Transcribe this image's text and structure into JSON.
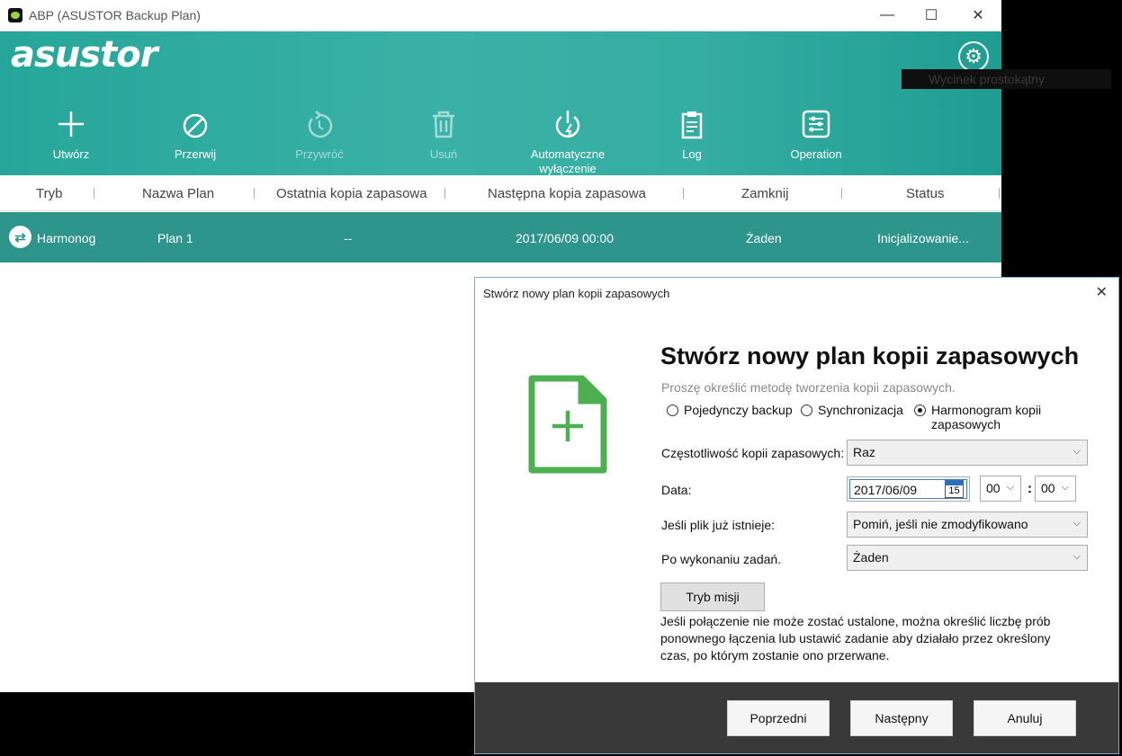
{
  "window": {
    "title": "ABP (ASUSTOR Backup Plan)",
    "minimize": "—",
    "maximize": "☐",
    "close": "✕"
  },
  "header": {
    "logo": "asustor",
    "settings_icon": "gear-icon"
  },
  "toolbar": [
    {
      "label": "Utwórz",
      "icon": "plus-icon",
      "enabled": true
    },
    {
      "label": "Przerwij",
      "icon": "cancel-icon",
      "enabled": true
    },
    {
      "label": "Przywróć",
      "icon": "restore-icon",
      "enabled": false
    },
    {
      "label": "Usuń",
      "icon": "trash-icon",
      "enabled": false
    },
    {
      "label": "Automatyczne wyłączenie",
      "icon": "power-icon",
      "enabled": true
    },
    {
      "label": "Log",
      "icon": "clipboard-icon",
      "enabled": true
    },
    {
      "label": "Operation",
      "icon": "sliders-icon",
      "enabled": true
    }
  ],
  "table": {
    "headers": [
      "Tryb",
      "Nazwa Plan",
      "Ostatnia kopia zapasowa",
      "Następna kopia zapasowa",
      "Zamknij",
      "Status"
    ],
    "rows": [
      {
        "tryb": "Harmonog",
        "nazwa": "Plan 1",
        "ostatnia": "--",
        "nastepna": "2017/06/09 00:00",
        "zamknij": "Żaden",
        "status": "Inicjalizowanie..."
      }
    ]
  },
  "snippet_overlay": "Wycinek prostokątny",
  "dialog": {
    "title": "Stwórz nowy plan kopii zapasowych",
    "heading": "Stwórz nowy plan kopii zapasowych",
    "subtitle": "Proszę określić metodę tworzenia kopii zapasowych.",
    "methods": [
      {
        "label": "Pojedynczy backup",
        "selected": false
      },
      {
        "label": "Synchronizacja",
        "selected": false
      },
      {
        "label": "Harmonogram kopii zapasowych",
        "selected": true
      }
    ],
    "frequency_label": "Częstotliwość kopii zapasowych:",
    "frequency_value": "Raz",
    "date_label": "Data:",
    "date_value": "2017/06/09",
    "calendar_day": "15",
    "hour_value": "00",
    "minute_value": "00",
    "time_separator": ":",
    "file_exists_label": "Jeśli plik już istnieje:",
    "file_exists_value": "Pomiń, jeśli nie zmodyfikowano",
    "after_tasks_label": "Po wykonaniu zadań.",
    "after_tasks_value": "Żaden",
    "mission_button": "Tryb misji",
    "info_text": "Jeśli połączenie nie może zostać ustalone, można określić liczbę prób ponownego łączenia lub ustawić zadanie aby działało przez określony czas, po którym zostanie ono przerwane.",
    "buttons": {
      "previous": "Poprzedni",
      "next": "Następny",
      "cancel": "Anuluj"
    }
  }
}
